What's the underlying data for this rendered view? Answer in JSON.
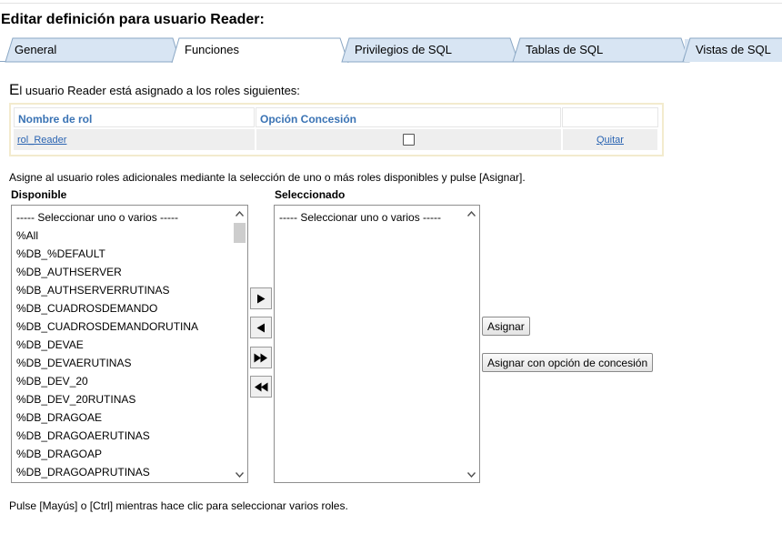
{
  "page": {
    "title": "Editar definición para usuario Reader:"
  },
  "tabs": [
    {
      "label": "General",
      "active": false
    },
    {
      "label": "Funciones",
      "active": true
    },
    {
      "label": "Privilegios de SQL",
      "active": false
    },
    {
      "label": "Tablas de SQL",
      "active": false
    },
    {
      "label": "Vistas de SQL",
      "active": false
    }
  ],
  "roles_section": {
    "intro_first_letter": "E",
    "intro_rest": "l usuario Reader está asignado a los roles siguientes:",
    "columns": [
      "Nombre de rol",
      "Opción Concesión",
      ""
    ],
    "rows": [
      {
        "role": "rol_Reader",
        "grant_option": false,
        "action": "Quitar"
      }
    ]
  },
  "assign_section": {
    "instruction": "Asigne al usuario roles adicionales mediante la selección de uno o más roles disponibles y pulse [Asignar].",
    "available_label": "Disponible",
    "selected_label": "Seleccionado",
    "available_items": [
      "----- Seleccionar uno o varios -----",
      "%All",
      "%DB_%DEFAULT",
      "%DB_AUTHSERVER",
      "%DB_AUTHSERVERRUTINAS",
      "%DB_CUADROSDEMANDO",
      "%DB_CUADROSDEMANDORUTINA",
      "%DB_DEVAE",
      "%DB_DEVAERUTINAS",
      "%DB_DEV_20",
      "%DB_DEV_20RUTINAS",
      "%DB_DRAGOAE",
      "%DB_DRAGOAERUTINAS",
      "%DB_DRAGOAP",
      "%DB_DRAGOAPRUTINAS"
    ],
    "selected_items": [
      "----- Seleccionar uno o varios -----"
    ],
    "move_buttons": {
      "add_one_icon": "play-right-icon",
      "remove_one_icon": "play-left-icon",
      "add_all_icon": "fast-forward-icon",
      "remove_all_icon": "fast-rewind-icon"
    },
    "assign_button": "Asignar",
    "assign_grant_button": "Asignar con opción de concesión"
  },
  "footer": {
    "hint": "Pulse [Mayús] o [Ctrl] mientras hace clic para seleccionar varios roles."
  },
  "colors": {
    "tab_fill": "#d8e5f3",
    "tab_border": "#8aa7c4",
    "header_text": "#3a73b4",
    "link": "#2a64b2",
    "panel_border": "#f3ebce",
    "row_bg": "#eeeeee"
  }
}
